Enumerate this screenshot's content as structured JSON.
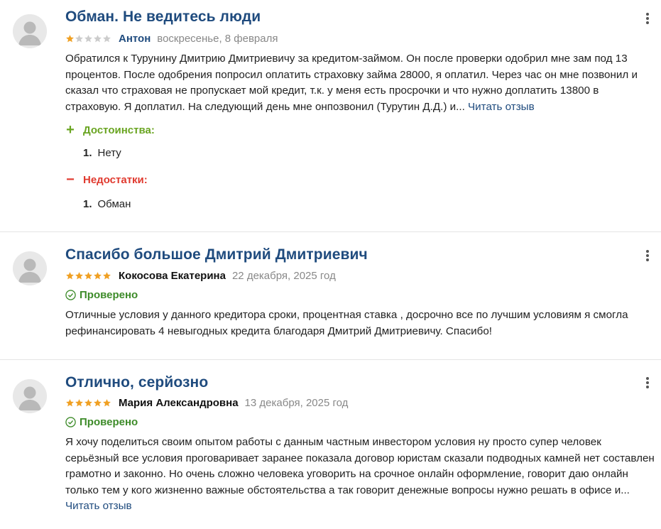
{
  "colors": {
    "title": "#1f4b7e",
    "star_filled": "#f0a023",
    "star_empty": "#cccccc",
    "verified": "#3d8b29",
    "pros": "#6aa522",
    "cons": "#e03a2f"
  },
  "reviews": [
    {
      "title": "Обман. Не ведитесь люди",
      "rating": 1,
      "author": "Антон",
      "date": "воскресенье, 8 февраля",
      "text": "Обратился к Турунину Дмитрию Дмитриевичу за кредитом-займом. Он после проверки одобрил мне зам под 13 процентов. После одобрения попросил оплатить страховку займа 28000, я оплатил. Через час он мне позвонил и сказал что страховая не пропускает мой кредит, т.к. у меня есть просрочки и что нужно доплатить 13800 в страховую. Я доплатил. На следующий день мне онпозвонил (Турутин Д.Д.) и...",
      "read_more": "Читать отзыв",
      "pros_label": "Достоинства:",
      "pros_items": [
        {
          "num": "1.",
          "text": "Нету"
        }
      ],
      "cons_label": "Недостатки:",
      "cons_items": [
        {
          "num": "1.",
          "text": "Обман"
        }
      ]
    },
    {
      "title": "Спасибо большое Дмитрий Дмитриевич",
      "rating": 5,
      "author": "Кокосова Екатерина",
      "date": "22 декабря, 2025 год",
      "verified": "Проверено",
      "text": "Отличные условия у данного кредитора сроки, процентная ставка , досрочно все по лучшим условиям я смогла рефинансировать 4 невыгодных кредита благодаря Дмитрий Дмитриевичу. Спасибо!"
    },
    {
      "title": "Отлично, серйозно",
      "rating": 5,
      "author": "Мария Александровна",
      "date": "13 декабря, 2025 год",
      "verified": "Проверено",
      "text": "Я хочу поделиться своим опытом работы с данным частным инвестором условия ну просто супер человек серьёзный все условия проговаривает заранее показала договор юристам сказали подводных камней нет составлен грамотно и законно. Но очень сложно человека уговорить на срочное онлайн оформление, говорит даю онлайн только тем у кого жизненно важные обстоятельства а так говорит денежные вопросы нужно решать в офисе и...",
      "read_more": "Читать отзыв"
    }
  ]
}
